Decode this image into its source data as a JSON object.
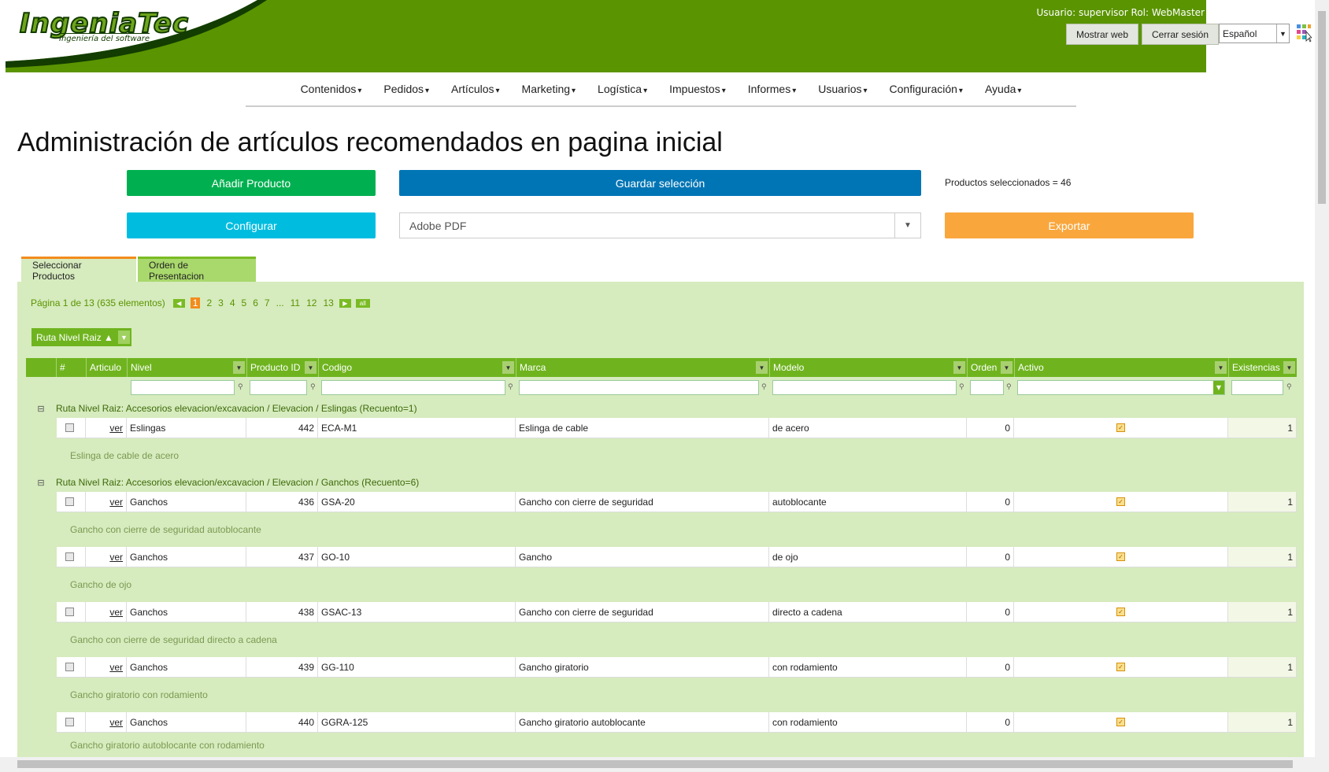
{
  "header": {
    "logo_text": "IngeniaTec",
    "logo_sub": "Ingeniería del software",
    "user_info": "Usuario: supervisor Rol: WebMaster",
    "show_web": "Mostrar web",
    "logout": "Cerrar sesión",
    "language": "Español",
    "brand_color": "#5a9400"
  },
  "nav": [
    "Contenidos",
    "Pedidos",
    "Artículos",
    "Marketing",
    "Logística",
    "Impuestos",
    "Informes",
    "Usuarios",
    "Configuración",
    "Ayuda"
  ],
  "page": {
    "title": "Administración de artículos recomendados en pagina inicial",
    "add_product": "Añadir Producto",
    "save_selection": "Guardar selección",
    "selected_count": "Productos seleccionados = 46",
    "configure": "Configurar",
    "export_format": "Adobe PDF",
    "export": "Exportar"
  },
  "tabs": [
    "Seleccionar Productos",
    "Orden de Presentacion"
  ],
  "pager": {
    "info": "Página 1 de 13 (635 elementos)",
    "pages": [
      "1",
      "2",
      "3",
      "4",
      "5",
      "6",
      "7",
      "...",
      "11",
      "12",
      "13"
    ],
    "current": "1",
    "all": "all"
  },
  "group_chip": "Ruta Nivel Raiz  ▲",
  "columns": [
    "#",
    "Articulo",
    "Nivel",
    "Producto ID",
    "Codigo",
    "Marca",
    "Modelo",
    "Orden",
    "Activo",
    "Existencias"
  ],
  "groups": [
    {
      "label": "Ruta Nivel Raiz: Accesorios elevacion/excavacion / Elevacion / Eslingas (Recuento=1)",
      "rows": [
        {
          "link": "ver",
          "nivel": "Eslingas",
          "id": "442",
          "codigo": "ECA-M1",
          "marca": "Eslinga de cable",
          "modelo": "de acero",
          "orden": "0",
          "existencias": "1",
          "desc": "Eslinga de cable de acero"
        }
      ]
    },
    {
      "label": "Ruta Nivel Raiz: Accesorios elevacion/excavacion / Elevacion / Ganchos (Recuento=6)",
      "rows": [
        {
          "link": "ver",
          "nivel": "Ganchos",
          "id": "436",
          "codigo": "GSA-20",
          "marca": "Gancho con cierre de seguridad",
          "modelo": "autoblocante",
          "orden": "0",
          "existencias": "1",
          "desc": "Gancho con cierre de seguridad autoblocante"
        },
        {
          "link": "ver",
          "nivel": "Ganchos",
          "id": "437",
          "codigo": "GO-10",
          "marca": "Gancho",
          "modelo": "de ojo",
          "orden": "0",
          "existencias": "1",
          "desc": "Gancho de ojo"
        },
        {
          "link": "ver",
          "nivel": "Ganchos",
          "id": "438",
          "codigo": "GSAC-13",
          "marca": "Gancho con cierre de seguridad",
          "modelo": "directo a cadena",
          "orden": "0",
          "existencias": "1",
          "desc": "Gancho con cierre de seguridad directo a cadena"
        },
        {
          "link": "ver",
          "nivel": "Ganchos",
          "id": "439",
          "codigo": "GG-110",
          "marca": "Gancho giratorio",
          "modelo": "con rodamiento",
          "orden": "0",
          "existencias": "1",
          "desc": "Gancho giratorio con rodamiento"
        },
        {
          "link": "ver",
          "nivel": "Ganchos",
          "id": "440",
          "codigo": "GGRA-125",
          "marca": "Gancho giratorio autoblocante",
          "modelo": "con rodamiento",
          "orden": "0",
          "existencias": "1",
          "desc": "Gancho giratorio autoblocante con rodamiento"
        }
      ]
    }
  ]
}
